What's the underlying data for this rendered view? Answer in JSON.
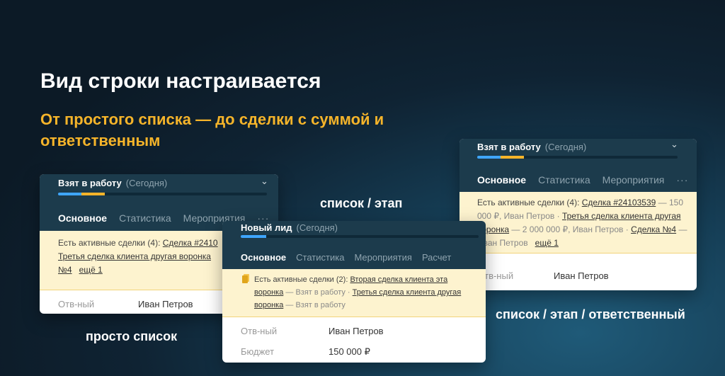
{
  "heading": "Вид строки настраивается",
  "subheading": "От простого списка — до сделки с суммой и ответственным",
  "labels": {
    "simple": "просто список",
    "stage": "список / этап",
    "full": "список / этап / ответственный"
  },
  "card1": {
    "title": "Взят в работу",
    "date": "(Сегодня)",
    "tabs": [
      "Основное",
      "Статистика",
      "Мероприятия"
    ],
    "more": "···",
    "alert_prefix": "Есть активные сделки (4):",
    "deal1": "Сделка #2410",
    "deal2": "Третья сделка клиента другая воронка",
    "deal3": "№4",
    "more_link": "ещё 1",
    "field_key": "Отв-ный",
    "field_val": "Иван Петров"
  },
  "card2": {
    "title": "Новый лид",
    "date": "(Сегодня)",
    "tabs": [
      "Основное",
      "Статистика",
      "Мероприятия",
      "Расчет"
    ],
    "alert_prefix": "Есть активные сделки (2):",
    "deal1": "Вторая сделка клиента эта воронка",
    "stage1": "— Взят в работу ·",
    "deal2": "Третья сделка клиента другая воронка",
    "stage2": "— Взят в работу",
    "field1_key": "Отв-ный",
    "field1_val": "Иван Петров",
    "field2_key": "Бюджет",
    "field2_val": "150 000 ₽"
  },
  "card3": {
    "title": "Взят в работу",
    "date": "(Сегодня)",
    "tabs": [
      "Основное",
      "Статистика",
      "Мероприятия"
    ],
    "more": "···",
    "alert_prefix": "Есть активные сделки (4):",
    "deal1": "Сделка #24103539",
    "deal1_info": "— 150 000 ₽, Иван Петров ·",
    "deal2": "Третья сделка клиента другая воронка",
    "deal2_info": "— 2 000 000 ₽, Иван Петров ·",
    "deal3": "Сделка №4",
    "deal3_info": "— Иван Петров",
    "more_link": "ещё 1",
    "field_key": "Отв-ный",
    "field_val": "Иван Петров"
  },
  "colors": {
    "yellow": "#f5b42a",
    "blue": "#3fa6ff",
    "header": "#1c3b4c"
  }
}
